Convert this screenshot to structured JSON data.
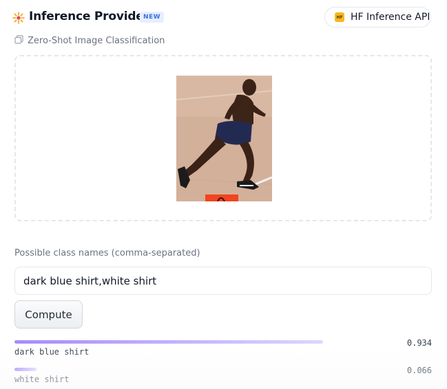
{
  "header": {
    "title": "Inference Providers",
    "badge": "NEW",
    "provider": {
      "logo_text": "HF",
      "label": "HF Inference API"
    }
  },
  "task": {
    "icon": "image-copy-icon",
    "label": "Zero-Shot Image Classification"
  },
  "dropzone": {
    "image_subject": "runner"
  },
  "classes": {
    "label": "Possible class names (comma-separated)",
    "value": "dark blue shirt,white shirt"
  },
  "compute_label": "Compute",
  "results": [
    {
      "label": "dark blue shirt",
      "score": "0.934",
      "fraction": 0.934
    },
    {
      "label": "white shirt",
      "score": "0.066",
      "fraction": 0.066
    }
  ],
  "colors": {
    "bar_start": "#a78bfa",
    "bar_end": "#ddd6fe",
    "badge_bg": "#e7efff",
    "badge_text": "#3b6fd8",
    "hf_logo": "#f5b81f"
  }
}
